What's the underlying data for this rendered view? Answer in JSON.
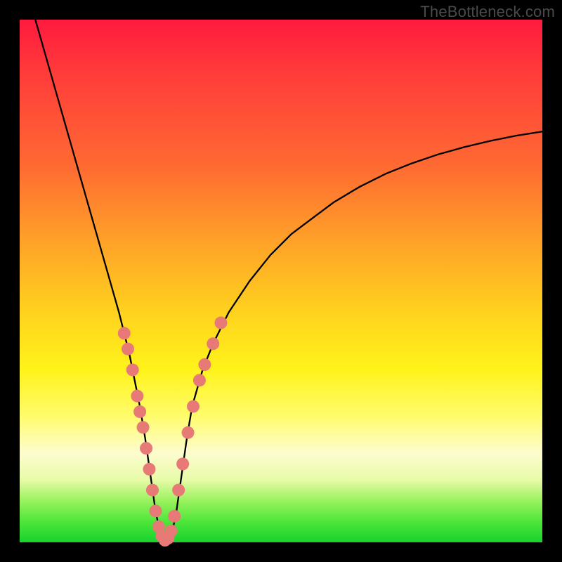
{
  "watermark": "TheBottleneck.com",
  "colors": {
    "frame": "#000000",
    "curve": "#000000",
    "marker": "#e77a76",
    "gradient_stops": [
      "#ff1a3e",
      "#ff3b3a",
      "#ff6a32",
      "#ffa028",
      "#ffd21e",
      "#fff31a",
      "#fffc6e",
      "#fdfccf",
      "#e8fba8",
      "#9af25f",
      "#4fe63a",
      "#18d12e"
    ]
  },
  "chart_data": {
    "type": "line",
    "title": "",
    "xlabel": "",
    "ylabel": "",
    "xlim": [
      0,
      100
    ],
    "ylim": [
      0,
      100
    ],
    "series": [
      {
        "name": "bottleneck-curve",
        "x": [
          3,
          5,
          7,
          9,
          11,
          13,
          15,
          17,
          19,
          20,
          21,
          22,
          23,
          24,
          25,
          26,
          27,
          28,
          29,
          30,
          31,
          32,
          33,
          35,
          37,
          40,
          44,
          48,
          52,
          56,
          60,
          65,
          70,
          75,
          80,
          85,
          90,
          95,
          100
        ],
        "y": [
          100,
          93,
          86,
          79,
          72,
          65,
          58,
          51,
          44,
          40,
          36,
          31,
          26,
          20,
          13,
          6,
          1,
          0,
          1,
          6,
          13,
          20,
          26,
          33,
          38,
          44,
          50,
          55,
          59,
          62,
          65,
          68,
          70.5,
          72.5,
          74.2,
          75.6,
          76.8,
          77.8,
          78.6
        ]
      }
    ],
    "markers": {
      "name": "bead-markers",
      "color": "#e77a76",
      "points": [
        {
          "x": 20.0,
          "y": 40
        },
        {
          "x": 20.7,
          "y": 37
        },
        {
          "x": 21.6,
          "y": 33
        },
        {
          "x": 22.5,
          "y": 28
        },
        {
          "x": 23.0,
          "y": 25
        },
        {
          "x": 23.6,
          "y": 22
        },
        {
          "x": 24.2,
          "y": 18
        },
        {
          "x": 24.8,
          "y": 14
        },
        {
          "x": 25.4,
          "y": 10
        },
        {
          "x": 26.0,
          "y": 6
        },
        {
          "x": 26.6,
          "y": 3
        },
        {
          "x": 27.2,
          "y": 1.2
        },
        {
          "x": 27.8,
          "y": 0.4
        },
        {
          "x": 28.4,
          "y": 0.8
        },
        {
          "x": 29.0,
          "y": 2.2
        },
        {
          "x": 29.6,
          "y": 5
        },
        {
          "x": 30.4,
          "y": 10
        },
        {
          "x": 31.2,
          "y": 15
        },
        {
          "x": 32.2,
          "y": 21
        },
        {
          "x": 33.2,
          "y": 26
        },
        {
          "x": 34.4,
          "y": 31
        },
        {
          "x": 35.4,
          "y": 34
        },
        {
          "x": 37.0,
          "y": 38
        },
        {
          "x": 38.5,
          "y": 42
        }
      ]
    }
  }
}
